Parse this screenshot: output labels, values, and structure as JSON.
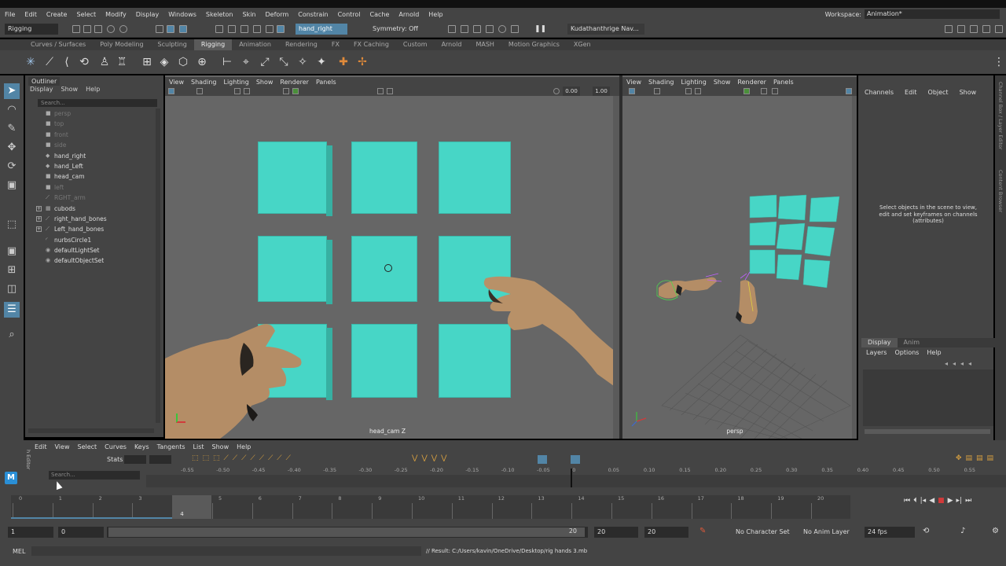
{
  "menubar": {
    "items": [
      "File",
      "Edit",
      "Create",
      "Select",
      "Modify",
      "Display",
      "Windows",
      "Skeleton",
      "Skin",
      "Deform",
      "Constrain",
      "Control",
      "Cache",
      "Arnold",
      "Help"
    ],
    "workspace_label": "Workspace:",
    "workspace_value": "Animation*"
  },
  "statusline": {
    "menuset": "Rigging",
    "object_field": "hand_right",
    "symmetry": "Symmetry: Off",
    "user": "Kudathanthrige Nav..."
  },
  "shelf": {
    "tabs": [
      "Curves / Surfaces",
      "Poly Modeling",
      "Sculpting",
      "Rigging",
      "Animation",
      "Rendering",
      "FX",
      "FX Caching",
      "Custom",
      "Arnold",
      "MASH",
      "Motion Graphics",
      "XGen"
    ],
    "active_tab": "Rigging"
  },
  "outliner": {
    "title": "Outliner",
    "menu": [
      "Display",
      "Show",
      "Help"
    ],
    "search_placeholder": "Search...",
    "items": [
      {
        "label": "persp",
        "icon": "camera-icon",
        "dim": true,
        "expand": ""
      },
      {
        "label": "top",
        "icon": "camera-icon",
        "dim": true,
        "expand": ""
      },
      {
        "label": "front",
        "icon": "camera-icon",
        "dim": true,
        "expand": ""
      },
      {
        "label": "side",
        "icon": "camera-icon",
        "dim": true,
        "expand": ""
      },
      {
        "label": "hand_right",
        "icon": "transform-icon",
        "dim": false,
        "expand": ""
      },
      {
        "label": "hand_Left",
        "icon": "transform-icon",
        "dim": false,
        "expand": ""
      },
      {
        "label": "head_cam",
        "icon": "camera-icon",
        "dim": false,
        "expand": ""
      },
      {
        "label": "left",
        "icon": "camera-icon",
        "dim": true,
        "expand": ""
      },
      {
        "label": "RGHT_arm",
        "icon": "joint-icon",
        "dim": true,
        "expand": ""
      },
      {
        "label": "cubods",
        "icon": "group-icon",
        "dim": false,
        "expand": "+"
      },
      {
        "label": "right_hand_bones",
        "icon": "joint-icon",
        "dim": false,
        "expand": "+"
      },
      {
        "label": "Left_hand_bones",
        "icon": "joint-icon",
        "dim": false,
        "expand": "+"
      },
      {
        "label": "nurbsCircle1",
        "icon": "curve-icon",
        "dim": false,
        "expand": ""
      },
      {
        "label": "defaultLightSet",
        "icon": "set-icon",
        "dim": false,
        "expand": ""
      },
      {
        "label": "defaultObjectSet",
        "icon": "set-icon",
        "dim": false,
        "expand": ""
      }
    ]
  },
  "viewport_left": {
    "menu": [
      "View",
      "Shading",
      "Lighting",
      "Show",
      "Renderer",
      "Panels"
    ],
    "exposure": "0.00",
    "gamma": "1.00",
    "camera_label": "head_cam Z"
  },
  "viewport_right": {
    "menu": [
      "View",
      "Shading",
      "Lighting",
      "Show",
      "Renderer",
      "Panels"
    ],
    "camera_label": "persp"
  },
  "channelbox": {
    "menu": [
      "Channels",
      "Edit",
      "Object",
      "Show"
    ],
    "hint": "Select objects in the scene to view, edit and set keyframes on channels (attributes)",
    "tabs": [
      "Display",
      "Anim"
    ],
    "layer_menu": [
      "Layers",
      "Options",
      "Help"
    ],
    "side_tabs": [
      "Channel Box / Layer Editor",
      "Content Browser"
    ]
  },
  "graph_editor": {
    "menu": [
      "Edit",
      "View",
      "Select",
      "Curves",
      "Keys",
      "Tangents",
      "List",
      "Show",
      "Help"
    ],
    "stats_label": "Stats",
    "search_placeholder": "Search...",
    "ruler": [
      "-0.55",
      "-0.50",
      "-0.45",
      "-0.40",
      "-0.35",
      "-0.30",
      "-0.25",
      "-0.20",
      "-0.15",
      "-0.10",
      "-0.05",
      "0",
      "0.05",
      "0.10",
      "0.15",
      "0.20",
      "0.25",
      "0.30",
      "0.35",
      "0.40",
      "0.45",
      "0.50",
      "0.55"
    ],
    "side_label": "h Editor"
  },
  "timeslider": {
    "frames": [
      "0",
      "1",
      "2",
      "3",
      "4",
      "5",
      "6",
      "7",
      "8",
      "9",
      "10",
      "11",
      "12",
      "13",
      "14",
      "15",
      "16",
      "17",
      "18",
      "19",
      "20"
    ],
    "current_frame": "4",
    "current_fraction": 0.2
  },
  "range": {
    "start": "1",
    "anim_start": "0",
    "range_end_inner": "20",
    "anim_end": "20",
    "end": "20",
    "character_set": "No Character Set",
    "anim_layer": "No Anim Layer",
    "fps": "24 fps"
  },
  "command": {
    "label": "MEL",
    "result": "// Result: C:/Users/kavin/OneDrive/Desktop/rig hands 3.mb"
  },
  "colors": {
    "cube": "#47d6c6",
    "skin": "#b8926a",
    "selection": "#5285a6",
    "playback_stop": "#d23a3a"
  }
}
